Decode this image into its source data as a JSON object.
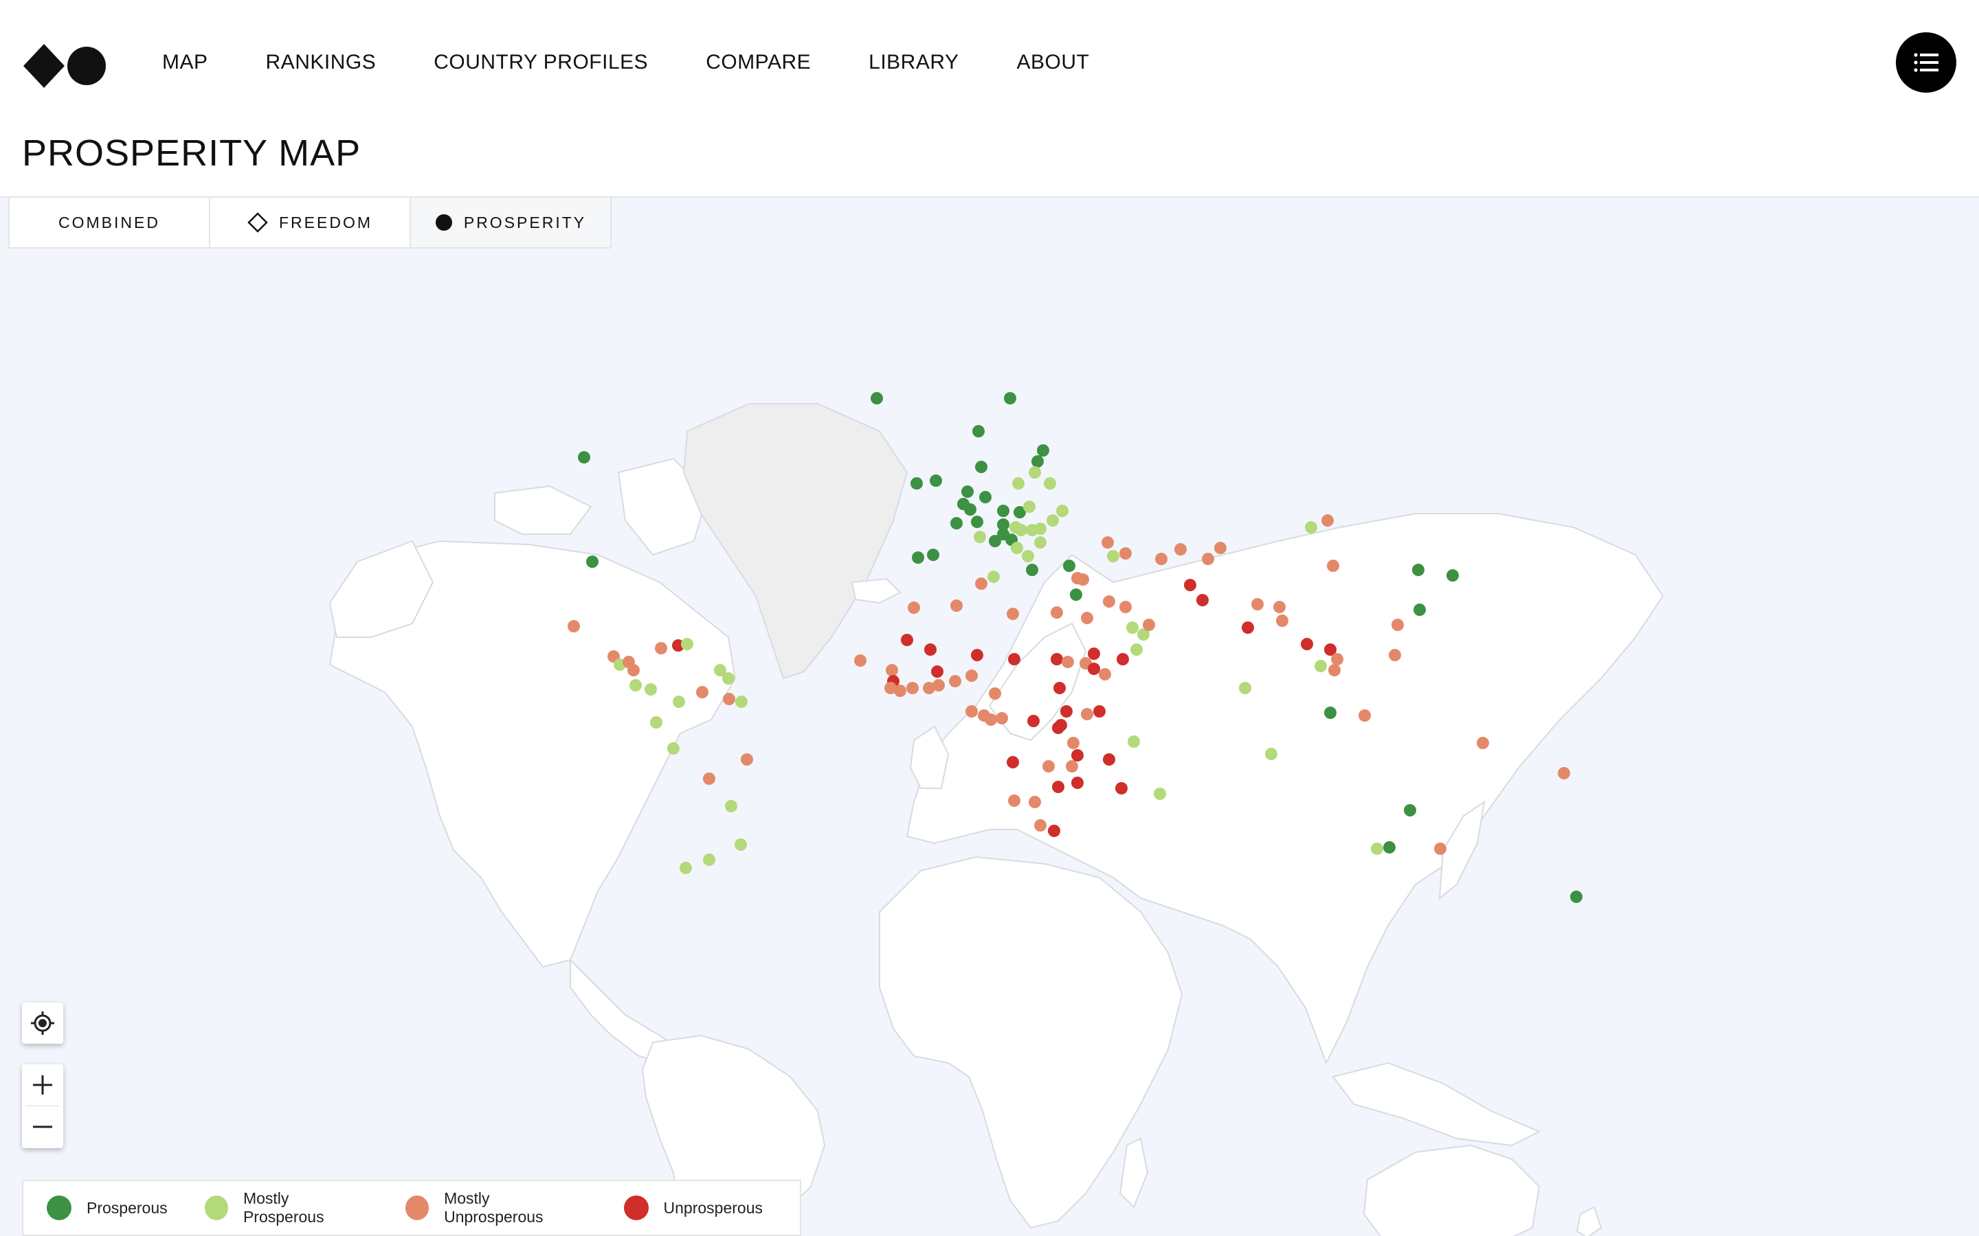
{
  "header": {
    "nav": [
      "MAP",
      "RANKINGS",
      "COUNTRY PROFILES",
      "COMPARE",
      "LIBRARY",
      "ABOUT"
    ],
    "menu_icon": "list-icon",
    "logo_icon": "diamond-circle-logo"
  },
  "page_title": "PROSPERITY MAP",
  "tabs": {
    "combined": "COMBINED",
    "freedom": "FREEDOM",
    "prosperity": "PROSPERITY",
    "active": "prosperity"
  },
  "controls": {
    "locate_icon": "locate-icon",
    "zoom_in_icon": "plus-icon",
    "zoom_out_icon": "minus-icon"
  },
  "legend": [
    {
      "label": "Prosperous",
      "color": "#3d9142"
    },
    {
      "label": "Mostly Prosperous",
      "color": "#b3d97a"
    },
    {
      "label": "Mostly Unprosperous",
      "color": "#e3896a"
    },
    {
      "label": "Unprosperous",
      "color": "#cf2e2a"
    }
  ],
  "colors": {
    "map_background": "#f2f6fc",
    "land": "#ffffff",
    "greenland": "#efefef",
    "border": "#d9dde3"
  }
}
